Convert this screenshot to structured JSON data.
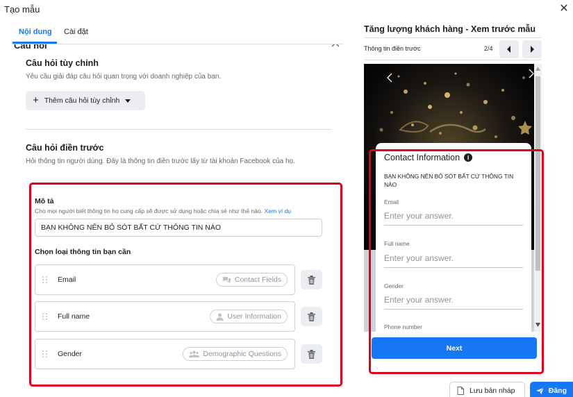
{
  "window": {
    "title": "Tạo mẫu"
  },
  "tabs": [
    {
      "label": "Nội dung",
      "active": true
    },
    {
      "label": "Cài đặt",
      "active": false
    }
  ],
  "section": {
    "heading": "Câu hỏi",
    "custom": {
      "title": "Câu hỏi tùy chỉnh",
      "desc": "Yêu cầu giải đáp câu hỏi quan trọng với doanh nghiệp của bạn.",
      "add_button": "Thêm câu hỏi tùy chỉnh"
    },
    "prefill": {
      "title": "Câu hỏi điền trước",
      "desc": "Hỏi thông tin người dùng. Đây là thông tin điền trước lấy từ tài khoản Facebook của họ."
    }
  },
  "description_panel": {
    "label": "Mô tả",
    "help": "Cho mọi người biết thông tin họ cung cấp sẽ được sử dụng hoặc chia sẻ như thế nào.",
    "help_link": "Xem ví dụ",
    "value": "BẠN KHÔNG NÊN BỎ SÓT BẤT CỨ THÔNG TIN NÀO",
    "choose_label": "Chọn loại thông tin bạn cần",
    "fields": [
      {
        "label": "Email",
        "category": "Contact Fields",
        "icon": "chat-bubbles-icon"
      },
      {
        "label": "Full name",
        "category": "User Information",
        "icon": "person-icon"
      },
      {
        "label": "Gender",
        "category": "Demographic Questions",
        "icon": "people-icon"
      }
    ]
  },
  "preview": {
    "title": "Tăng lượng khách hàng - Xem trước mẫu",
    "subtitle": "Thông tin điền trước",
    "page_counter": "2/4",
    "card": {
      "heading": "Contact Information",
      "desc": "BẠN KHÔNG NÊN BỎ SÓT BẤT CỨ THÔNG TIN NÀO",
      "fields": [
        {
          "label": "Email",
          "placeholder": "Enter your answer."
        },
        {
          "label": "Full name",
          "placeholder": "Enter your answer."
        },
        {
          "label": "Gender",
          "placeholder": "Enter your answer."
        },
        {
          "label": "Phone number",
          "placeholder": ""
        }
      ],
      "next_button": "Next"
    }
  },
  "footer": {
    "draft_button": "Lưu bản nháp",
    "post_button": "Đăng"
  },
  "colors": {
    "accent": "#1877f2",
    "highlight_frame": "#e0001b",
    "chip_text": "#8d949e"
  }
}
